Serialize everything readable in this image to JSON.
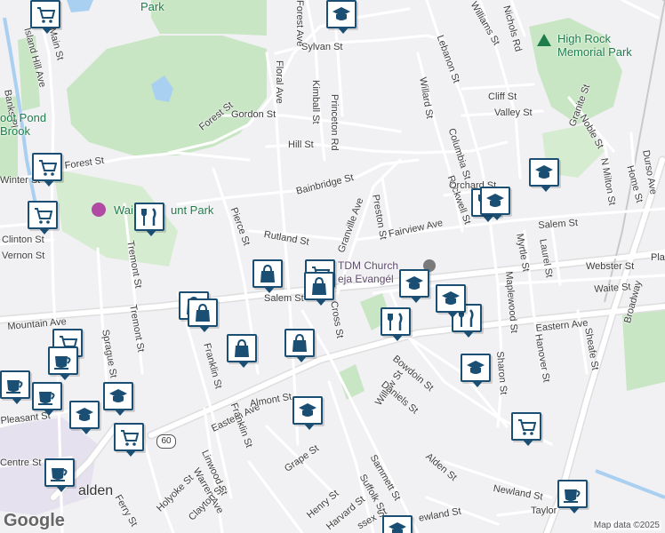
{
  "map": {
    "colors": {
      "land": "#f1f1f4",
      "park": "#c8e6c4",
      "water": "#a9d0f0",
      "road": "#ffffff",
      "highway": "#e8e8e8",
      "pin_border": "#1a4e73"
    },
    "streets": [
      {
        "id": "forest-ave",
        "text": "Forest Ave"
      },
      {
        "id": "sylvan-st",
        "text": "Sylvan St"
      },
      {
        "id": "floral-ave",
        "text": "Floral Ave"
      },
      {
        "id": "kimball-st",
        "text": "Kimball St"
      },
      {
        "id": "princeton-rd",
        "text": "Princeton Rd"
      },
      {
        "id": "gordon-st",
        "text": "Gordon St"
      },
      {
        "id": "hill-st",
        "text": "Hill St"
      },
      {
        "id": "forest-st-upper",
        "text": "Forest St"
      },
      {
        "id": "forest-st-lower",
        "text": "Forest St"
      },
      {
        "id": "bainbridge-st",
        "text": "Bainbridge St"
      },
      {
        "id": "rutland-st",
        "text": "Rutland St"
      },
      {
        "id": "granville-ave",
        "text": "Granville Ave"
      },
      {
        "id": "preston-st",
        "text": "Preston St"
      },
      {
        "id": "fairview-ave",
        "text": "Fairview Ave"
      },
      {
        "id": "rockwell-st",
        "text": "Rockwell St"
      },
      {
        "id": "orchard-st",
        "text": "Orchard St"
      },
      {
        "id": "columbia-st",
        "text": "Columbia St"
      },
      {
        "id": "willard-st",
        "text": "Willard St"
      },
      {
        "id": "lebanon-st",
        "text": "Lebanon St"
      },
      {
        "id": "cliff-st",
        "text": "Cliff St"
      },
      {
        "id": "valley-st",
        "text": "Valley St"
      },
      {
        "id": "williams-st",
        "text": "Williams St"
      },
      {
        "id": "nichols-rd",
        "text": "Nichols Rd"
      },
      {
        "id": "granite-st",
        "text": "Granite St"
      },
      {
        "id": "noble-st",
        "text": "Noble St"
      },
      {
        "id": "n-milton-st",
        "text": "N Milton St"
      },
      {
        "id": "home-st",
        "text": "Home St"
      },
      {
        "id": "durso-ave",
        "text": "Durso Ave"
      },
      {
        "id": "salem-st-east",
        "text": "Salem St"
      },
      {
        "id": "salem-st-west",
        "text": "Salem St"
      },
      {
        "id": "laurel-st",
        "text": "Laurel St"
      },
      {
        "id": "myrtle-st",
        "text": "Myrtle St"
      },
      {
        "id": "maplewood-st",
        "text": "Maplewood St"
      },
      {
        "id": "webster-st",
        "text": "Webster St"
      },
      {
        "id": "waite-st",
        "text": "Waite St"
      },
      {
        "id": "eastern-ave-east",
        "text": "Eastern Ave"
      },
      {
        "id": "eastern-ave-west",
        "text": "Eastern Ave"
      },
      {
        "id": "hanover-st",
        "text": "Hanover St"
      },
      {
        "id": "sheafe-st",
        "text": "Sheafe St"
      },
      {
        "id": "broadway",
        "text": "Broadway"
      },
      {
        "id": "sharon-st",
        "text": "Sharon St"
      },
      {
        "id": "pierce-st",
        "text": "Pierce St"
      },
      {
        "id": "mountain-ave",
        "text": "Mountain Ave"
      },
      {
        "id": "clinton-st",
        "text": "Clinton St"
      },
      {
        "id": "vernon-st",
        "text": "Vernon St"
      },
      {
        "id": "winter-st",
        "text": "Winter St"
      },
      {
        "id": "tremont-st-1",
        "text": "Tremont St"
      },
      {
        "id": "tremont-st-2",
        "text": "Tremont St"
      },
      {
        "id": "sprague-st",
        "text": "Sprague St"
      },
      {
        "id": "franklin-st-1",
        "text": "Franklin St"
      },
      {
        "id": "franklin-st-2",
        "text": "Franklin St"
      },
      {
        "id": "cross-st",
        "text": "Cross St"
      },
      {
        "id": "willow-st",
        "text": "Willow St"
      },
      {
        "id": "bowdoin-st",
        "text": "Bowdoin St"
      },
      {
        "id": "daniels-st",
        "text": "Daniels St"
      },
      {
        "id": "almont-st",
        "text": "Almont St"
      },
      {
        "id": "pleasant-st",
        "text": "Pleasant St"
      },
      {
        "id": "centre-st",
        "text": "Centre St"
      },
      {
        "id": "linwood-st",
        "text": "Linwood St"
      },
      {
        "id": "warren-ave",
        "text": "Warren Ave"
      },
      {
        "id": "grape-st",
        "text": "Grape St"
      },
      {
        "id": "sammett-st",
        "text": "Sammett St"
      },
      {
        "id": "suffolk-st",
        "text": "Suffolk St"
      },
      {
        "id": "alden-st",
        "text": "Alden St"
      },
      {
        "id": "newland-st",
        "text": "Newland St"
      },
      {
        "id": "taylor-st",
        "text": "Taylor"
      },
      {
        "id": "ferry-st",
        "text": "Ferry St"
      },
      {
        "id": "holyoke-st",
        "text": "Holyoke St"
      },
      {
        "id": "clayton-st",
        "text": "Clayton St"
      },
      {
        "id": "main-st",
        "text": "Main St"
      },
      {
        "id": "island-hill-ave",
        "text": "Island Hill Ave"
      },
      {
        "id": "banks-pl",
        "text": "Banks Pl"
      },
      {
        "id": "henry-st",
        "text": "Henry St"
      },
      {
        "id": "harvard-st",
        "text": "Harvard St"
      },
      {
        "id": "essex-st",
        "text": "ssex St"
      },
      {
        "id": "newland-st-2",
        "text": "ewland St"
      },
      {
        "id": "pla",
        "text": "Pla"
      },
      {
        "id": "route-60",
        "text": "60"
      }
    ],
    "parks": [
      {
        "id": "high-rock-park",
        "text": "High Rock\nMemorial Park"
      },
      {
        "id": "waitt-mount-park",
        "text": "Wai"
      },
      {
        "id": "waitt-mount-park-2",
        "text": "unt Park"
      },
      {
        "id": "pond-brook",
        "text": "oot Pond\nBrook"
      },
      {
        "id": "park-top",
        "text": "Park"
      }
    ],
    "pois": [
      {
        "id": "church",
        "text": "TDM Church"
      },
      {
        "id": "church-2",
        "text": "eja Evangél"
      },
      {
        "id": "malden",
        "text": "alden"
      }
    ],
    "markers": [
      {
        "id": "m1",
        "type": "cart-icon"
      },
      {
        "id": "m2",
        "type": "school-icon"
      },
      {
        "id": "m3",
        "type": "cart-icon"
      },
      {
        "id": "m4",
        "type": "cart-icon"
      },
      {
        "id": "m5",
        "type": "restaurant-icon"
      },
      {
        "id": "m6",
        "type": "shopping-bag-icon"
      },
      {
        "id": "m7",
        "type": "cart-icon"
      },
      {
        "id": "m8",
        "type": "shopping-bag-icon"
      },
      {
        "id": "m9",
        "type": "shopping-bag-icon"
      },
      {
        "id": "m10",
        "type": "shopping-bag-icon"
      },
      {
        "id": "m11",
        "type": "shopping-bag-icon"
      },
      {
        "id": "m12",
        "type": "school-icon"
      },
      {
        "id": "m13",
        "type": "shopping-bag-icon"
      },
      {
        "id": "m14",
        "type": "restaurant-icon"
      },
      {
        "id": "m15",
        "type": "restaurant-icon"
      },
      {
        "id": "m16",
        "type": "restaurant-icon"
      },
      {
        "id": "m17",
        "type": "school-icon"
      },
      {
        "id": "m18",
        "type": "school-icon"
      },
      {
        "id": "m19",
        "type": "school-icon"
      },
      {
        "id": "m20",
        "type": "cart-icon"
      },
      {
        "id": "m21",
        "type": "coffee-icon"
      },
      {
        "id": "m22",
        "type": "coffee-icon"
      },
      {
        "id": "m23",
        "type": "coffee-icon"
      },
      {
        "id": "m24",
        "type": "school-icon"
      },
      {
        "id": "m25",
        "type": "school-icon"
      },
      {
        "id": "m26",
        "type": "cart-icon"
      },
      {
        "id": "m27",
        "type": "school-icon"
      },
      {
        "id": "m28",
        "type": "cart-icon"
      },
      {
        "id": "m29",
        "type": "coffee-icon"
      },
      {
        "id": "m30",
        "type": "coffee-icon"
      },
      {
        "id": "m31",
        "type": "school-icon"
      },
      {
        "id": "m32",
        "type": "school-icon"
      }
    ],
    "attribution": "Map data ©2025",
    "logo": "Google"
  }
}
